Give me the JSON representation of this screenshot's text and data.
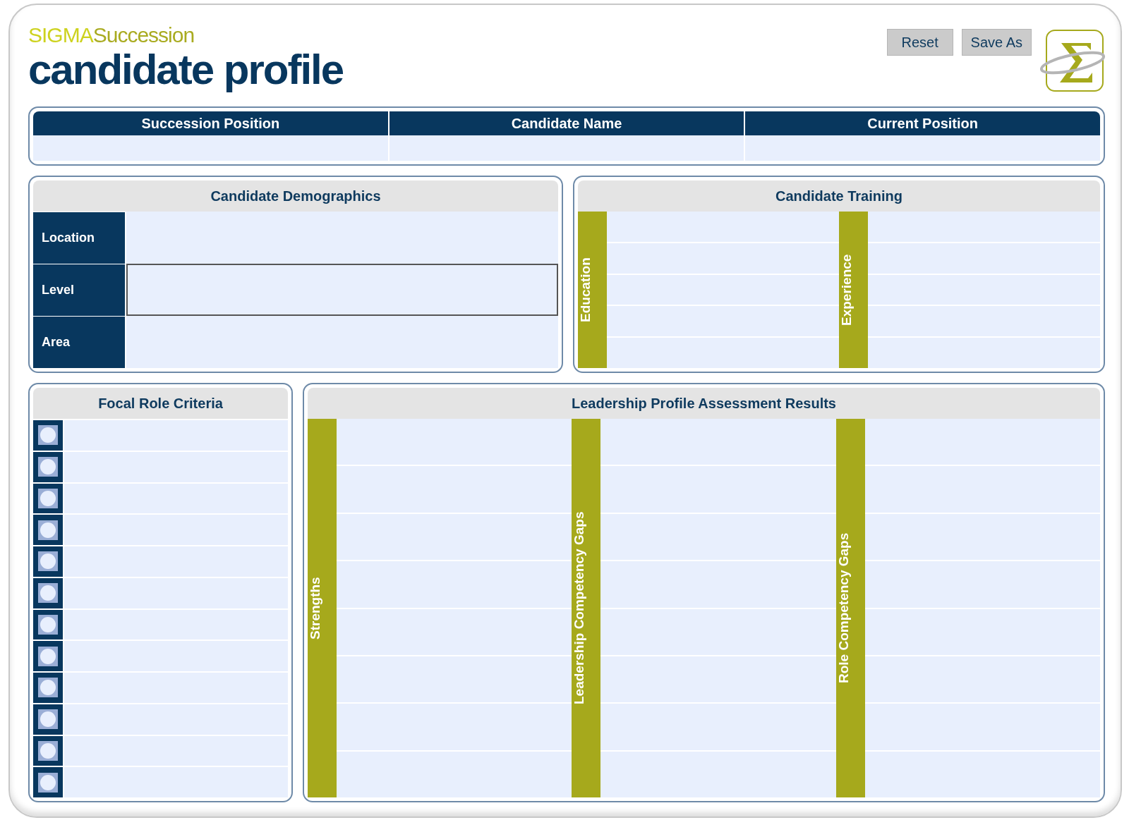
{
  "brand": {
    "prefix": "SIGMA",
    "suffix": "Succession"
  },
  "title": "candidate profile",
  "buttons": [
    "Reset",
    "Save As"
  ],
  "header_table": {
    "columns": [
      "Succession Position",
      "Candidate Name",
      "Current Position"
    ]
  },
  "demographics": {
    "title": "Candidate Demographics",
    "fields": [
      {
        "label": "Location",
        "focused": false
      },
      {
        "label": "Level",
        "focused": true
      },
      {
        "label": "Area",
        "focused": false
      }
    ]
  },
  "training": {
    "title": "Candidate Training",
    "groups": [
      {
        "label": "Education"
      },
      {
        "label": "Experience"
      }
    ]
  },
  "focal_role": {
    "title": "Focal Role Criteria",
    "criteria": [
      {
        "checked": false
      },
      {
        "checked": false
      },
      {
        "checked": false
      },
      {
        "checked": false
      },
      {
        "checked": false
      },
      {
        "checked": false
      },
      {
        "checked": false
      },
      {
        "checked": false
      },
      {
        "checked": false
      },
      {
        "checked": false
      },
      {
        "checked": false
      },
      {
        "checked": false
      }
    ]
  },
  "assessment": {
    "title": "Leadership Profile Assessment Results",
    "groups": [
      {
        "label": "Strengths"
      },
      {
        "label": "Leadership Competency Gaps"
      },
      {
        "label": "Role Competency Gaps"
      }
    ]
  }
}
